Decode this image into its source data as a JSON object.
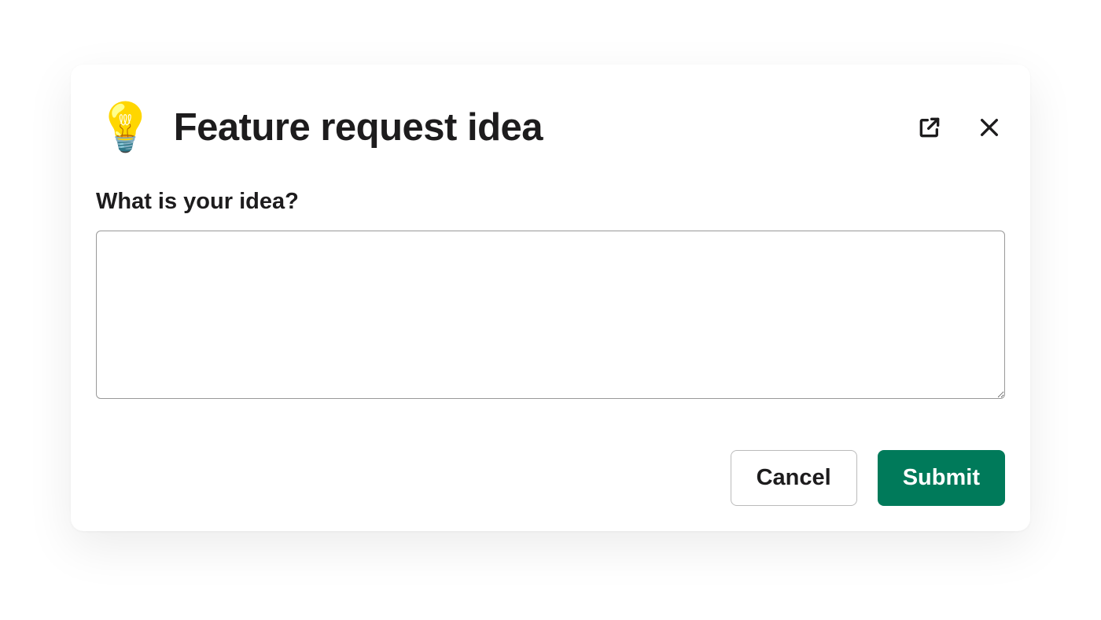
{
  "modal": {
    "icon": "💡",
    "title": "Feature request idea",
    "form": {
      "label": "What is your idea?",
      "value": ""
    },
    "actions": {
      "cancel": "Cancel",
      "submit": "Submit"
    }
  }
}
